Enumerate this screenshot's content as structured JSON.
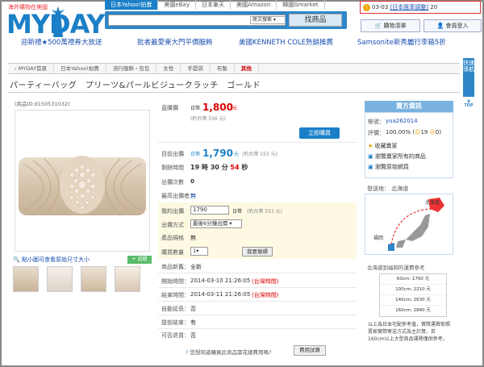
{
  "header": {
    "logo_small_prefix": "海外購物在",
    "logo_small_highlight": "美國",
    "logo_text": "MYDAY",
    "top_tabs": [
      "日本Yahoo!拍賣",
      "美國eBay",
      "日本東天",
      "美國Amazon",
      "韓國Gmarket"
    ],
    "search_category": "原文搜索",
    "search_button": "找商品",
    "notice_date": "03-03",
    "notice_link": "[日本匯率調整]",
    "notice_count": "20",
    "cart_button": "購物清單",
    "login_button": "會員登入"
  },
  "promos": [
    "迎新禮★500萬禮券大放送",
    "批者最愛東大門平價服飾",
    "美國KENNETH COLE熱銷推薦",
    "Samsonite新秀麗行李箱5折"
  ],
  "breadcrumb": [
    "MYDAY首頁",
    "日本Yahoo!拍賣",
    "流行服飾・包包",
    "女性",
    "手提袋",
    "布製",
    "其他"
  ],
  "side_nav": {
    "label": "快速導航",
    "top": "TOP"
  },
  "product": {
    "title": "パーティーバッグ　プリーツ&パールビジュークラッチ　ゴールド",
    "id": "(商品ID:d150531032)",
    "zoom_hint": "點小圖可查看原始尺寸大小",
    "add_fav": "+ 追蹤"
  },
  "pricing": {
    "buy_price_label": "直購價",
    "jpy": "日幣",
    "buy_price": "1,800",
    "yuan": "元",
    "buy_price_twd": "(約台幣 556 元)",
    "buy_now": "立即購買",
    "current_price_label": "目前出價",
    "current_price": "1,790",
    "current_price_twd": "(約台幣 553 元)",
    "time_left_label": "剩餘時間",
    "time_left_hm": "19 時 30 分",
    "time_left_s": "54",
    "time_left_sec_unit": "秒",
    "bid_count_label": "出價次數",
    "bid_count": "0",
    "top_bidder_label": "最高出價者：",
    "top_bidder": "無"
  },
  "bid": {
    "my_bid_label": "我的出價",
    "my_bid_value": "1790",
    "my_bid_unit": "日幣",
    "my_bid_twd": "(約台幣 553 元)",
    "method_label": "出價方式",
    "method_value": "最後6分鐘出價",
    "spec_label": "產品規格",
    "spec_value": "無",
    "qty_label": "購買數量",
    "qty_value": "1",
    "bid_button": "我要競標"
  },
  "details": [
    {
      "label": "商品新舊：",
      "value": "全新",
      "extra": ""
    },
    {
      "label": "開始時間：",
      "value": "2014-03-10 21:26:05",
      "extra": "(台灣時間)"
    },
    {
      "label": "結束時間：",
      "value": "2014-03-11 21:26:05",
      "extra": "(台灣時間)"
    },
    {
      "label": "自動延長：",
      "value": "否",
      "extra": ""
    },
    {
      "label": "提前結束：",
      "value": "有",
      "extra": ""
    },
    {
      "label": "可否退貨：",
      "value": "否",
      "extra": ""
    }
  ],
  "seller": {
    "heading": "賣方資訊",
    "account_label": "帳號：",
    "account": "yua262014",
    "rating_label": "評價：",
    "rating": "100.00%",
    "rating_count": "19",
    "rating_zero": "0",
    "links": [
      "收藏賣家",
      "瀏覽賣家所有的商品",
      "瀏覽原始網頁"
    ],
    "location_label": "發送地：",
    "location": "北海道",
    "map_origin": "北海道",
    "map_dest": "福岡"
  },
  "shipping": {
    "title": "北海道到福岡的運費參考",
    "rows": [
      "60cm: 1790 元",
      "100cm: 2210 元",
      "140cm: 2630 元",
      "160cm: 2840 元"
    ],
    "note": "以上為日本宅配參考值，實際運費依照賣家實際寄送方式為主計算，若160cm以上大型商品運費僅供參考。"
  },
  "footer": {
    "feedback": "您想知道購買此商品需花總費用嗎?",
    "try_button": "費用試算"
  },
  "colors": {
    "accent": "#1a7fc7",
    "price_red": "#dd0000",
    "bid_bg": "#fdf9e3"
  }
}
